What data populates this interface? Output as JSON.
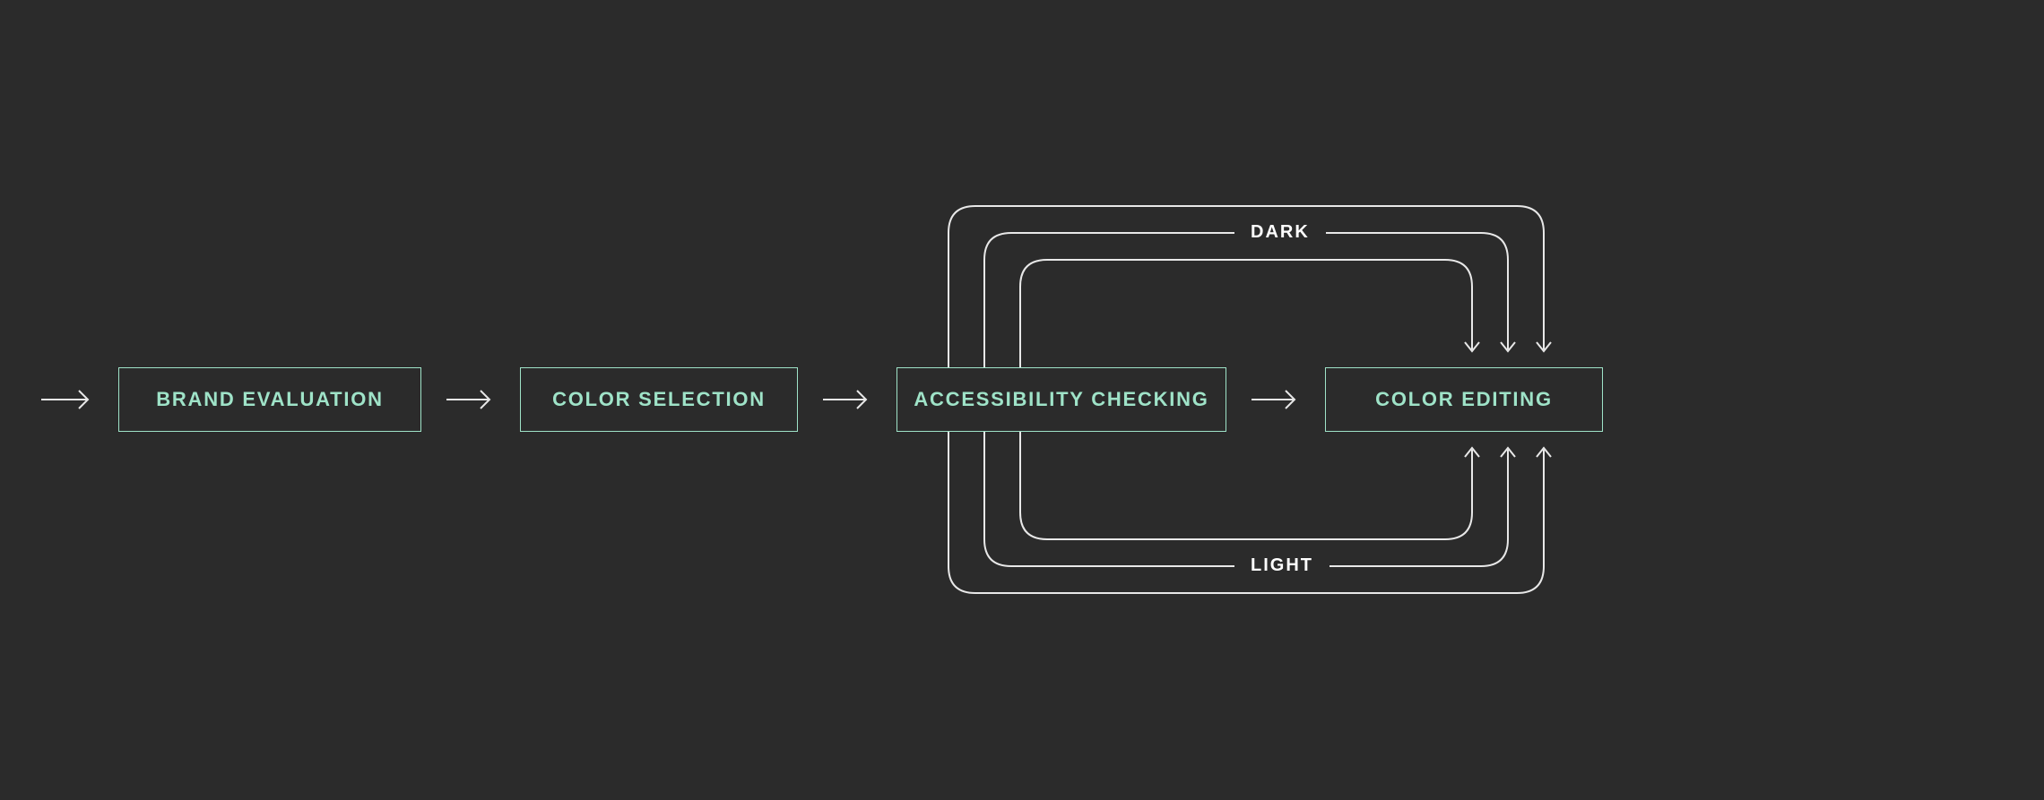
{
  "diagram": {
    "nodes": {
      "brand_evaluation": "Brand Evaluation",
      "color_selection": "Color Selection",
      "accessibility_checking": "Accessibility Checking",
      "color_editing": "Color Editing"
    },
    "loop_labels": {
      "dark": "DARK",
      "light": "LIGHT"
    },
    "colors": {
      "bg": "#2b2b2b",
      "accent": "#9fe3c8",
      "line": "#e8e8e8",
      "label_text": "#ffffff"
    }
  }
}
